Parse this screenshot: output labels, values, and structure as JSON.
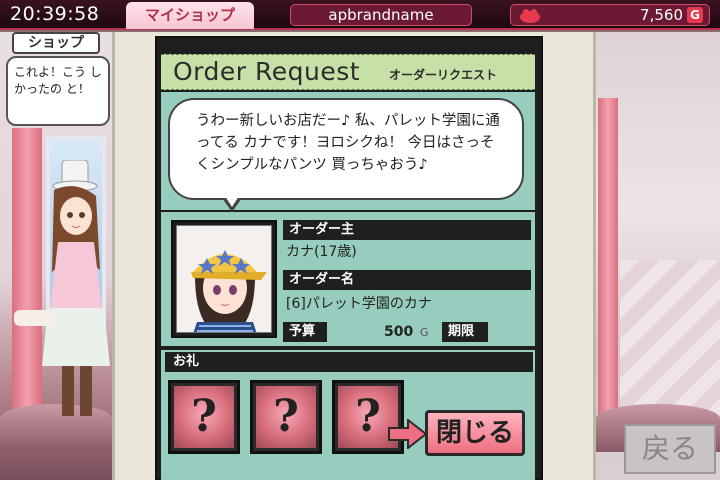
{
  "status_bar": {
    "clock": "20:39:58",
    "tab_label": "マイショップ",
    "player_name": "apbrandname",
    "money": "7,560",
    "currency_symbol": "G"
  },
  "background": {
    "shop_label": "ショップ",
    "npc_speech": "これよ！こう しかったの と！"
  },
  "order": {
    "title": "Order Request",
    "subtitle": "オーダーリクエスト",
    "message": "うわー新しいお店だー♪ 私、パレット学園に通ってる カナです！ヨロシクね！ 今日はさっそくシンプルなパンツ 買っちゃおう♪",
    "client_label": "オーダー主",
    "client_value": "カナ(17歳)",
    "order_name_label": "オーダー名",
    "order_name_value": "[6]パレット学園のカナ",
    "budget_label": "予算",
    "budget_value": "500",
    "budget_currency": "G",
    "deadline_label": "期限",
    "reward_label": "お礼",
    "reward_slots": [
      "?",
      "?",
      "?"
    ]
  },
  "buttons": {
    "close": "閉じる",
    "back": "戻る"
  },
  "colors": {
    "accent": "#b8324a",
    "panel_teal": "#96cdbf",
    "header_green": "#c7e0a8",
    "button_pink": "#ef6f82"
  }
}
